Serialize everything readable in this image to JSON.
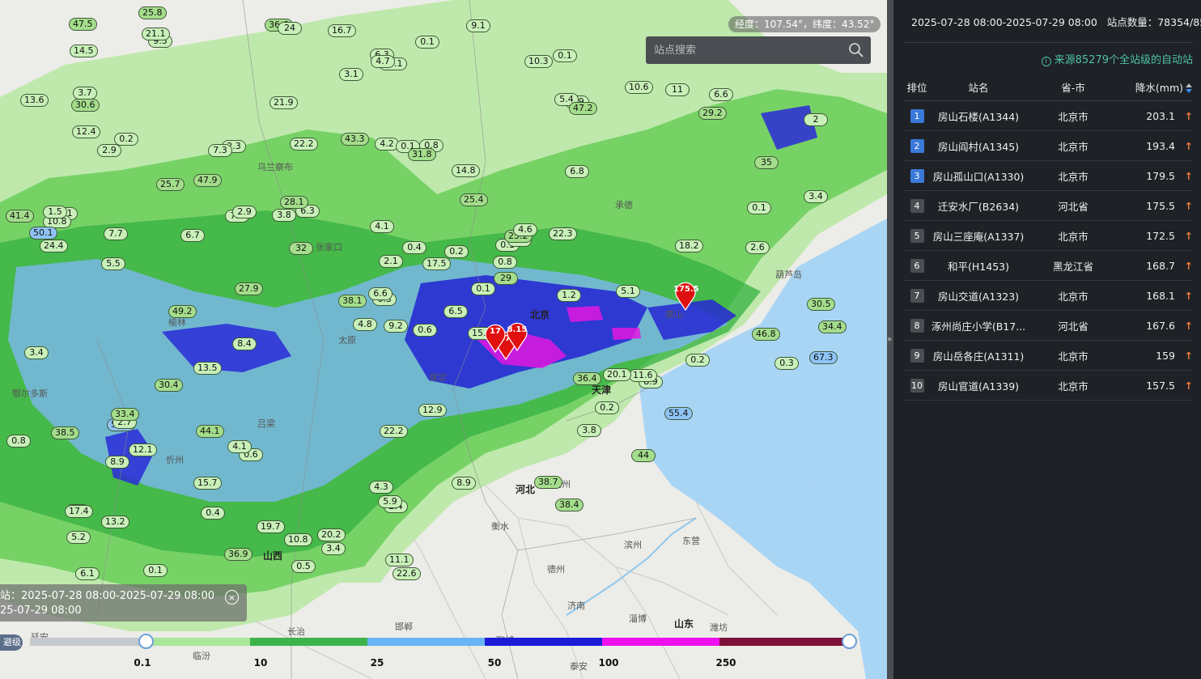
{
  "map": {
    "coordinate_text": "经度：107.54°，纬度：43.52°",
    "search_placeholder": "站点搜索",
    "time_info": {
      "line1": "站：2025-07-28 08:00-2025-07-29 08:00",
      "line2": "25-07-29 08:00",
      "close": "×"
    },
    "level_label": "避级",
    "legend": {
      "colors": [
        "#c4c9cc",
        "#a8e79a",
        "#3cb44a",
        "#68b4f4",
        "#1b1bd8",
        "#f00ff0",
        "#7d1038"
      ],
      "ticks": [
        "0.1",
        "10",
        "25",
        "50",
        "100",
        "250"
      ]
    },
    "places": [
      {
        "text": "乌兰察布",
        "cls": ""
      },
      {
        "text": "北京",
        "cls": "big"
      },
      {
        "text": "天津",
        "cls": "big"
      },
      {
        "text": "河北",
        "cls": "big"
      },
      {
        "text": "山西",
        "cls": "big"
      },
      {
        "text": "山东",
        "cls": "big"
      },
      {
        "text": "沧州",
        "cls": ""
      },
      {
        "text": "衡水",
        "cls": ""
      },
      {
        "text": "德州",
        "cls": ""
      },
      {
        "text": "滨州",
        "cls": ""
      },
      {
        "text": "东营",
        "cls": ""
      },
      {
        "text": "济南",
        "cls": ""
      },
      {
        "text": "淄博",
        "cls": ""
      },
      {
        "text": "潍坊",
        "cls": ""
      },
      {
        "text": "泰安",
        "cls": ""
      },
      {
        "text": "邯郸",
        "cls": ""
      },
      {
        "text": "长治",
        "cls": ""
      },
      {
        "text": "临汾",
        "cls": ""
      },
      {
        "text": "聊城",
        "cls": ""
      },
      {
        "text": "承德",
        "cls": ""
      },
      {
        "text": "葫芦岛",
        "cls": ""
      },
      {
        "text": "鄂尔多斯",
        "cls": ""
      },
      {
        "text": "榆林",
        "cls": ""
      },
      {
        "text": "延安",
        "cls": ""
      },
      {
        "text": "忻州",
        "cls": ""
      },
      {
        "text": "太原",
        "cls": ""
      },
      {
        "text": "吕梁",
        "cls": ""
      },
      {
        "text": "张家口",
        "cls": ""
      },
      {
        "text": "保定",
        "cls": ""
      },
      {
        "text": "唐山",
        "cls": ""
      }
    ],
    "stations": [
      "0.6",
      "2.9",
      "6.3",
      "2.9",
      "0.1",
      "0.6",
      "0.1",
      "0.8",
      "0.9",
      "0.1",
      "9.5",
      "5.5",
      "2",
      "4.8",
      "6.8",
      "0.1",
      "4.2",
      "25.4",
      "12.1",
      "6.3",
      "5.2",
      "0.4",
      "0.1",
      "6.9",
      "8.9",
      "0.2",
      "16.1",
      "24.4",
      "36.4",
      "3.4",
      "6.6",
      "4.3",
      "2.1",
      "2.3",
      "10.6",
      "4.1",
      "11.6",
      "9.1",
      "3.8",
      "6.7",
      "3.8",
      "36.9",
      "41.4",
      "0.8",
      "6.1",
      "2.4",
      "29",
      "8.9",
      "35",
      "13.6",
      "0.2",
      "38.4",
      "15.7",
      "21.1",
      "47.5",
      "8.9",
      "6.6",
      "0.1",
      "27.9",
      "3.1",
      "47.9",
      "11",
      "25.8",
      "10.3",
      "3.1",
      "0.4",
      "0.8",
      "22.2",
      "10.8",
      "20.1",
      "7.5",
      "17.4",
      "14.5",
      "25.7",
      "3.4",
      "4.1",
      "0.2",
      "13.2",
      "1.2",
      "11.1",
      "2.6",
      "12.9",
      "38.7",
      "6.3",
      "34.4",
      "22.3",
      "44",
      "17.5",
      "10.8",
      "22.6",
      "5.4",
      "47.2",
      "49.2",
      "36.6",
      "30.5",
      "50.1",
      "30.4",
      "44.1",
      "19.7",
      "25.2",
      "29.2",
      "32",
      "46.8",
      "30.6",
      "31.8",
      "38.1",
      "24",
      "38.5",
      "9.2",
      "43.3",
      "16.7",
      "59.2",
      "14.8",
      "22.2",
      "5.1",
      "13.5",
      "3.4",
      "18.2",
      "12.4",
      "2.7",
      "2.9",
      "21.9",
      "0.3",
      "55.4",
      "8.4",
      "33.4",
      "67.3",
      "28.1",
      "15.1",
      "7.7",
      "6.5",
      "4.6",
      "3.7",
      "20.2",
      "5.9",
      "4.7",
      "0.1",
      "7.3",
      "1.5",
      "0.5",
      "0.2"
    ],
    "pins": [
      {
        "label": "175.5"
      },
      {
        "label": "167.6"
      },
      {
        "label": "17"
      },
      {
        "label": "8.15"
      }
    ]
  },
  "panel": {
    "time_range": "2025-07-28 08:00-2025-07-29 08:00",
    "station_count": "站点数量：78354/85279",
    "source_note": "来源85279个全站级的自动站",
    "headers": {
      "rank": "排位",
      "name": "站名",
      "province": "省-市",
      "value": "降水(mm)"
    },
    "rows": [
      {
        "rank": "1",
        "name": "房山石楼(A1344)",
        "province": "北京市",
        "value": "203.1"
      },
      {
        "rank": "2",
        "name": "房山阎村(A1345)",
        "province": "北京市",
        "value": "193.4"
      },
      {
        "rank": "3",
        "name": "房山孤山口(A1330)",
        "province": "北京市",
        "value": "179.5"
      },
      {
        "rank": "4",
        "name": "迁安水厂(B2634)",
        "province": "河北省",
        "value": "175.5"
      },
      {
        "rank": "5",
        "name": "房山三座庵(A1337)",
        "province": "北京市",
        "value": "172.5"
      },
      {
        "rank": "6",
        "name": "和平(H1453)",
        "province": "黑龙江省",
        "value": "168.7"
      },
      {
        "rank": "7",
        "name": "房山交道(A1323)",
        "province": "北京市",
        "value": "168.1"
      },
      {
        "rank": "8",
        "name": "涿州尚庄小学(B17...",
        "province": "河北省",
        "value": "167.6"
      },
      {
        "rank": "9",
        "name": "房山岳各庄(A1311)",
        "province": "北京市",
        "value": "159"
      },
      {
        "rank": "10",
        "name": "房山官道(A1339)",
        "province": "北京市",
        "value": "157.5"
      }
    ],
    "arrow": "↑"
  }
}
